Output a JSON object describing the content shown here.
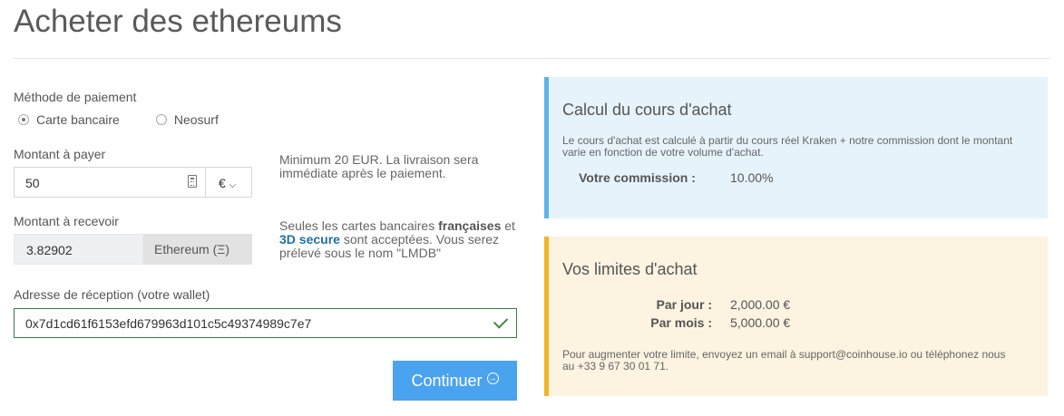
{
  "page": {
    "title": "Acheter des ethereums"
  },
  "payment": {
    "label": "Méthode de paiement",
    "options": [
      "Carte bancaire",
      "Neosurf"
    ],
    "selected": "Carte bancaire"
  },
  "amount": {
    "label": "Montant à payer",
    "value": "50",
    "currency": "€",
    "hint": "Minimum 20 EUR. La livraison sera immédiate après le paiement."
  },
  "receive": {
    "label": "Montant à recevoir",
    "value": "3.82902",
    "unit": "Ethereum (Ξ)",
    "hint_prefix": "Seules les cartes bancaires",
    "hint_bold": "françaises",
    "hint_and": "et",
    "hint_blue": "3D secure",
    "hint_suffix": "sont acceptées. Vous serez prélevé sous le nom \"LMDB\""
  },
  "wallet": {
    "label": "Adresse de réception (votre wallet)",
    "value": "0x7d1cd61f6153efd679963d101c5c49374989c7e7"
  },
  "continue_label": "Continuer",
  "rate_panel": {
    "title": "Calcul du cours d'achat",
    "description": "Le cours d'achat est calculé à partir du cours réel Kraken + notre commission dont le montant varie en fonction de votre volume d'achat.",
    "commission_label": "Votre commission :",
    "commission_value": "10.00%",
    "accent": "#5bb5e8"
  },
  "limits_panel": {
    "title": "Vos limites d'achat",
    "day_label": "Par jour :",
    "day_value": "2,000.00 €",
    "month_label": "Par mois :",
    "month_value": "5,000.00 €",
    "note": "Pour augmenter votre limite, envoyez un email à support@coinhouse.io ou téléphonez nous au +33 9 67 30 01 71.",
    "accent": "#f2b525"
  },
  "colors": {
    "button": "#4aa3ee",
    "valid": "#3f8a3f"
  },
  "icons": [
    "calculator-icon",
    "chevron-down-icon",
    "check-icon",
    "arrow-circle-right-icon"
  ]
}
